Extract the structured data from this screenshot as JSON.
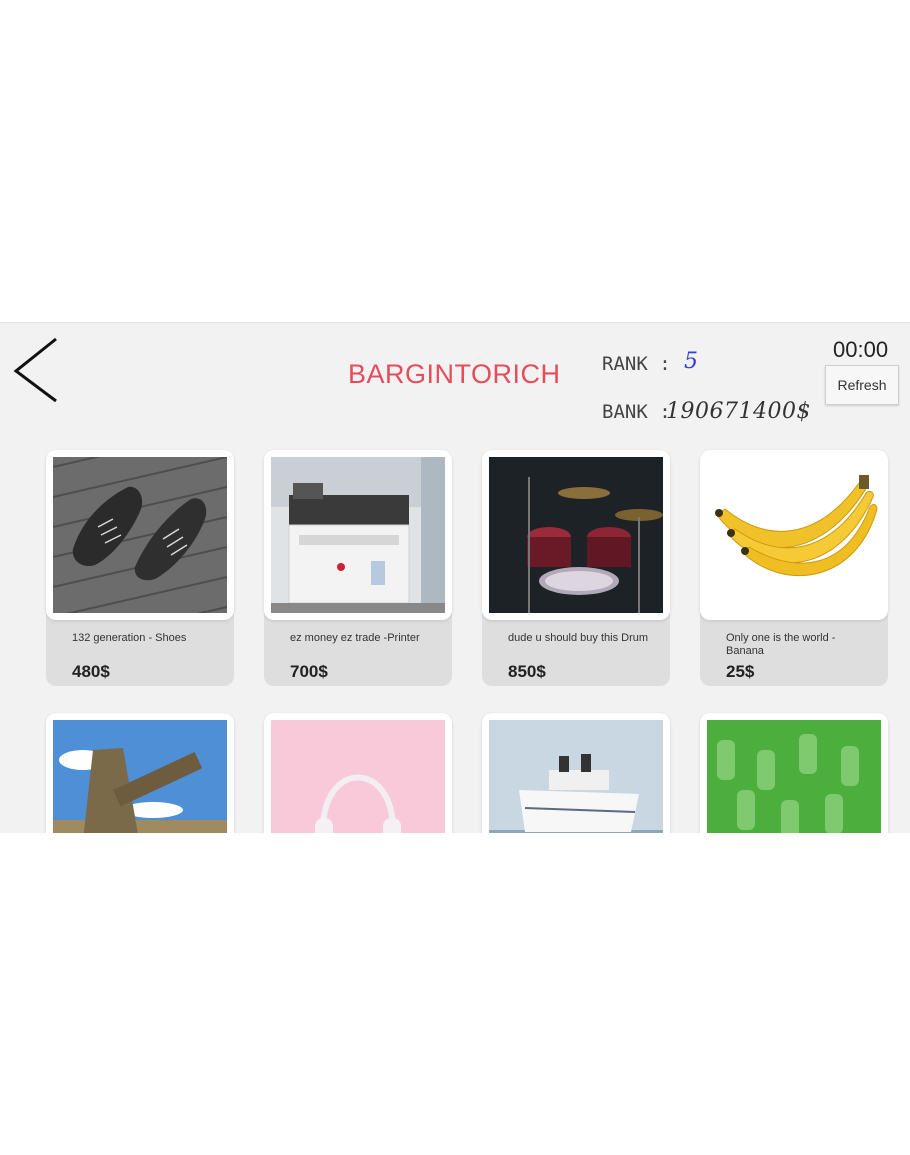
{
  "header": {
    "title": "BARGINTORICH",
    "rank_label": "RANK :",
    "rank_value": "5",
    "bank_label": "BANK :",
    "bank_value": "190671400$",
    "timer": "00:00",
    "refresh_label": "Refresh"
  },
  "colors": {
    "title": "#e44d5b",
    "rank_value": "#2f3fd6",
    "background": "#f2f2f2",
    "card": "#dedede"
  },
  "products": [
    {
      "name": "132 generation - Shoes",
      "price": "480$",
      "image": "shoes-image"
    },
    {
      "name": "ez money ez trade -Printer",
      "price": "700$",
      "image": "printer-image"
    },
    {
      "name": "dude u should buy this Drum",
      "price": "850$",
      "image": "drum-image"
    },
    {
      "name": "Only one is the world - Banana",
      "price": "25$",
      "image": "banana-image"
    },
    {
      "name": "",
      "price": "",
      "image": "cannon-image"
    },
    {
      "name": "",
      "price": "",
      "image": "headphones-image"
    },
    {
      "name": "",
      "price": "",
      "image": "cruise-ship-image"
    },
    {
      "name": "",
      "price": "",
      "image": "toy-soldiers-image"
    }
  ]
}
